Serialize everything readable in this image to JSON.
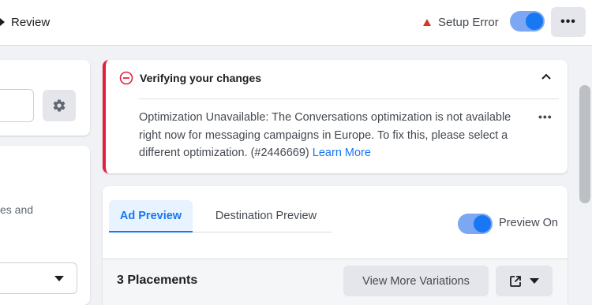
{
  "topbar": {
    "review_label": "Review",
    "setup_error_label": "Setup Error",
    "toggle_on": true,
    "more_label": "•••"
  },
  "left": {
    "partial_text": "es and"
  },
  "error_card": {
    "title": "Verifying your changes",
    "message": "Optimization Unavailable: The Conversations optimization is not available right now for messaging campaigns in Europe. To fix this, please select a different optimization. (#2446669)",
    "link_label": "Learn More",
    "more_label": "•••"
  },
  "preview": {
    "tabs": [
      {
        "label": "Ad Preview",
        "active": true
      },
      {
        "label": "Destination Preview",
        "active": false
      }
    ],
    "toggle_label": "Preview On",
    "toggle_on": true,
    "placements_label": "3 Placements",
    "view_more_label": "View More Variations"
  },
  "colors": {
    "accent": "#1877f2",
    "error": "#e41e3f",
    "warning": "#d8352a"
  }
}
